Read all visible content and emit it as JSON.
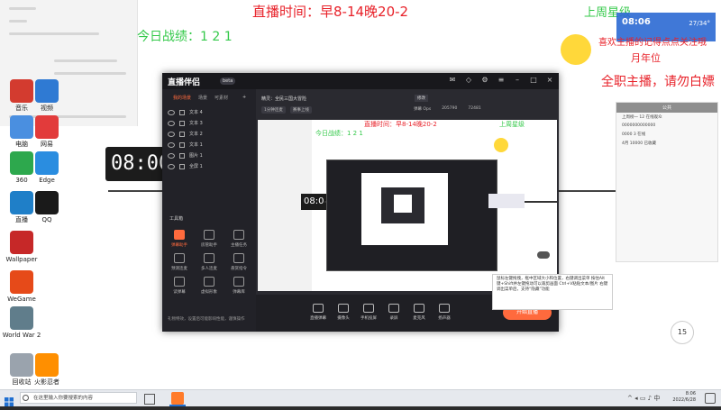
{
  "overlays": {
    "live_time": "直播时间：早8-14晚20-2",
    "today_record": "今日战绩：1 2 1",
    "last_week_top": "上周星级",
    "follow_tip": "喜欢主播的记得点点关注哦",
    "monthly_rank": "月年位",
    "fulltime": "全职主播，请勿白嫖",
    "clock": "08:00",
    "clock_small": "08:0"
  },
  "weather": {
    "time": "08:06",
    "temp": "27/34°"
  },
  "desktop_icons": [
    {
      "label": "音乐",
      "color": "#d33b2f"
    },
    {
      "label": "视频",
      "color": "#2f7ad3"
    },
    {
      "label": "电脑",
      "color": "#4a8fe0"
    },
    {
      "label": "网易",
      "color": "#e23b3b"
    },
    {
      "label": "Edge",
      "color": "#2a8de0"
    },
    {
      "label": "360",
      "color": "#2da84d"
    },
    {
      "label": "直播",
      "color": "#1f7fc8"
    },
    {
      "label": "QQ",
      "color": "#1a1a1a"
    },
    {
      "label": "Wallpaper",
      "color": "#c62828"
    },
    {
      "label": "WeGame",
      "color": "#e64a19"
    },
    {
      "label": "World War 2",
      "color": "#607d8b"
    },
    {
      "label": "回收站",
      "color": "#9aa3ad"
    },
    {
      "label": "火影忍者",
      "color": "#ff8f00"
    }
  ],
  "app": {
    "logo": "直播伴侣",
    "version": "beta",
    "tabs": [
      {
        "label": "我的场景",
        "active": true
      },
      {
        "label": "场景"
      },
      {
        "label": "可素材"
      }
    ],
    "scenes": [
      "文本 4",
      "文本 3",
      "文本 2",
      "文本 1",
      "图片 1",
      "全屏 1"
    ],
    "tools_label": "工具箱",
    "tools": [
      {
        "label": "弹幕助手",
        "active": true
      },
      {
        "label": "房管助手"
      },
      {
        "label": "主播任务"
      },
      {
        "label": "预测连麦"
      },
      {
        "label": "多人连麦"
      },
      {
        "label": "悬赏指令"
      },
      {
        "label": "读弹幕"
      },
      {
        "label": "虚拟形象"
      },
      {
        "label": "弹幕库"
      }
    ],
    "footer_note": "礼物特效，设置后可能影响性能，谨慎操作",
    "info_title": "精灵：全民三国大冒险",
    "info_btn": "修改",
    "tags": [
      "1分钟连麦",
      "赛事上线"
    ],
    "stats": [
      "弹幕 Ops",
      "205790",
      "72481"
    ],
    "bottom": [
      "直播弹幕",
      "摄像头",
      "手机投屏",
      "录屏",
      "麦克风",
      "扬声器"
    ],
    "start": "开始直播"
  },
  "tooltip": "鼠标左键拖拽，框中区域大小和位置，右键调出菜单 按住Alt键+Shift并左键拖动可以裁剪画面 Ctrl+V粘贴文本/图片 右键调出菜单后，支持“隐藏”功能",
  "right_panel": {
    "title": "公共",
    "rows": [
      "上周榜一 12 在线观众",
      "0000000000000",
      "0000 3 在线",
      "4月 10000 已收藏"
    ]
  },
  "badge": "15",
  "taskbar": {
    "search_placeholder": "在这里输入你要搜索的内容",
    "time": "8:06",
    "date": "2022/6/28"
  }
}
